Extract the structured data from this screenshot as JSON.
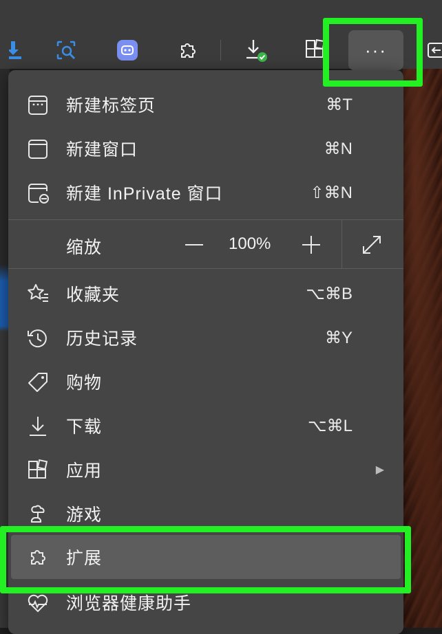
{
  "toolbar": {
    "icons": [
      "download-arrow-icon",
      "screenshot-search-icon",
      "copilot-icon",
      "extensions-puzzle-icon",
      "downloads-done-icon",
      "apps-grid-icon"
    ],
    "more_label": "···"
  },
  "menu": {
    "items": [
      {
        "label": "新建标签页",
        "shortcut": "⌘T",
        "icon": "new-tab-icon"
      },
      {
        "label": "新建窗口",
        "shortcut": "⌘N",
        "icon": "new-window-icon"
      },
      {
        "label": "新建 InPrivate 窗口",
        "shortcut": "⇧⌘N",
        "icon": "inprivate-window-icon"
      },
      {
        "label": "收藏夹",
        "shortcut": "⌥⌘B",
        "icon": "favorites-star-icon"
      },
      {
        "label": "历史记录",
        "shortcut": "⌘Y",
        "icon": "history-clock-icon"
      },
      {
        "label": "购物",
        "shortcut": "",
        "icon": "shopping-tag-icon"
      },
      {
        "label": "下载",
        "shortcut": "⌥⌘L",
        "icon": "download-icon"
      },
      {
        "label": "应用",
        "shortcut": "",
        "icon": "apps-icon",
        "submenu_arrow": "▶"
      },
      {
        "label": "游戏",
        "shortcut": "",
        "icon": "games-icon"
      },
      {
        "label": "扩展",
        "shortcut": "",
        "icon": "extensions-icon"
      },
      {
        "label": "浏览器健康助手",
        "shortcut": "",
        "icon": "browser-health-icon"
      }
    ],
    "zoom": {
      "label": "缩放",
      "value": "100%",
      "minus": "—",
      "plus": "+"
    }
  },
  "colors": {
    "highlight": "#22f022",
    "menu_bg": "#454545",
    "toolbar_bg": "#3b3b3b",
    "accent_blue": "#3a8ee6"
  }
}
